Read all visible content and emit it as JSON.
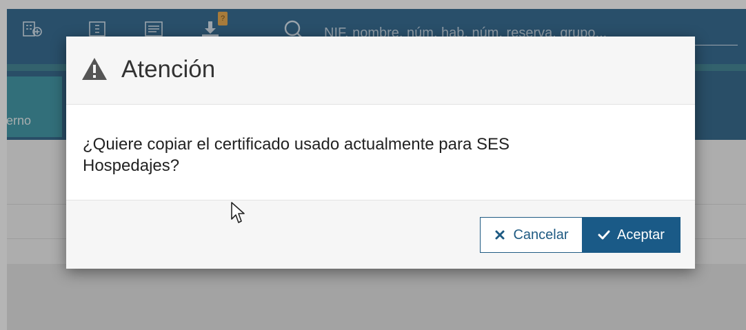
{
  "topbar": {
    "icons": [
      "building-add-icon",
      "building-icon",
      "list-icon",
      "download-icon"
    ],
    "download_badge": "?",
    "search": {
      "icon": "search-icon",
      "placeholder": "NIF, nombre, núm. hab, núm. reserva, grupo..."
    }
  },
  "background": {
    "tile_label": "terno"
  },
  "dialog": {
    "icon": "warning-icon",
    "title": "Atención",
    "message": "¿Quiere copiar el certificado usado actualmente para SES Hospedajes?",
    "buttons": {
      "cancel": {
        "label": "Cancelar",
        "icon": "close-icon"
      },
      "accept": {
        "label": "Aceptar",
        "icon": "check-icon"
      }
    }
  },
  "colors": {
    "brand_dark": "#1d5b86",
    "accent_teal": "#2d8fa0",
    "primary_button": "#1a5a87"
  }
}
